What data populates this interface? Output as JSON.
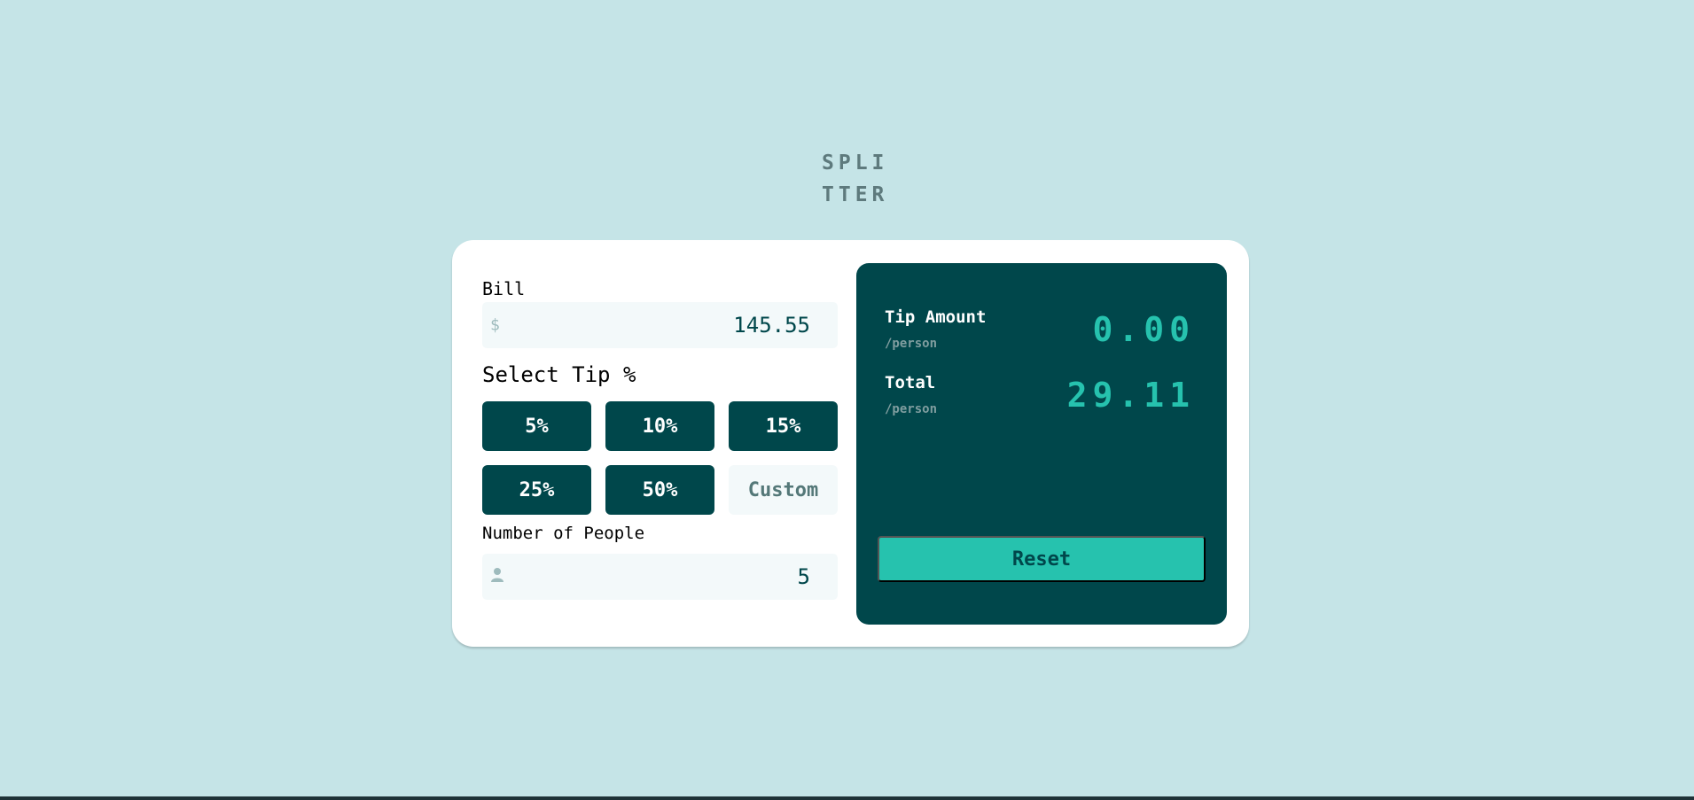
{
  "logo": {
    "line1": "SPLI",
    "line2": "TTER"
  },
  "bill": {
    "label": "Bill",
    "currency_icon": "$",
    "value": "145.55"
  },
  "tip": {
    "label": "Select Tip %",
    "options": [
      "5%",
      "10%",
      "15%",
      "25%",
      "50%"
    ],
    "custom_placeholder": "Custom"
  },
  "people": {
    "label": "Number of People",
    "value": "5"
  },
  "results": {
    "tip_label": "Tip Amount",
    "tip_sub": "/person",
    "tip_value": "0.00",
    "total_label": "Total",
    "total_sub": "/person",
    "total_value": "29.11"
  },
  "reset_label": "Reset",
  "colors": {
    "background": "#c5e4e7",
    "dark_cyan": "#00474b",
    "accent": "#26c2ae",
    "field_bg": "#f3f9fa"
  }
}
